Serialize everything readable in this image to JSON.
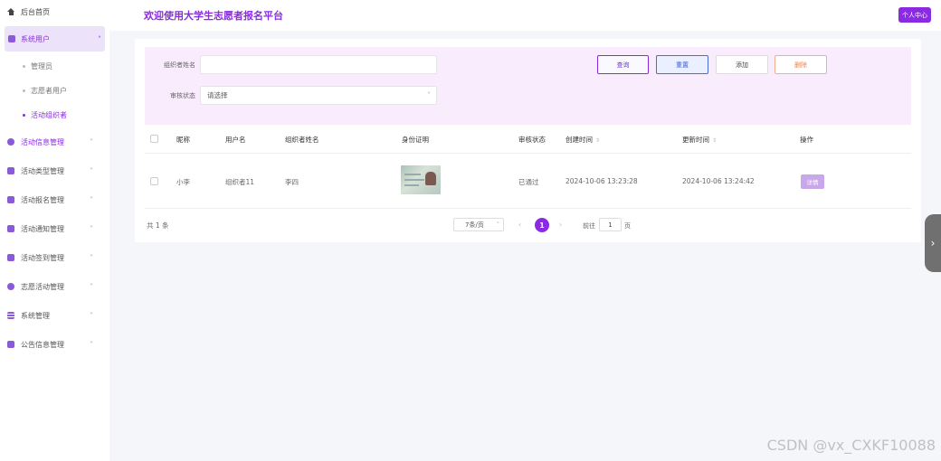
{
  "sidebar": {
    "home": "后台首页",
    "group": "系统用户",
    "subitems": [
      "管理员",
      "志愿者用户",
      "活动组织者"
    ],
    "items": [
      "活动信息管理",
      "活动类型管理",
      "活动报名管理",
      "活动通知管理",
      "活动签到管理",
      "志愿活动管理",
      "系统管理",
      "公告信息管理"
    ]
  },
  "header": {
    "title": "欢迎使用大学生志愿者报名平台",
    "profile": "个人中心"
  },
  "filter": {
    "name_label": "组织者姓名",
    "name_value": "",
    "status_label": "审核状态",
    "status_placeholder": "请选择",
    "buttons": {
      "search": "查询",
      "reset": "重置",
      "add": "添加",
      "delete": "删除"
    }
  },
  "table": {
    "headers": [
      "昵称",
      "用户名",
      "组织者姓名",
      "身份证明",
      "审核状态",
      "创建时间",
      "更新时间",
      "操作"
    ],
    "rows": [
      {
        "nickname": "小李",
        "username": "组织者11",
        "name": "李四",
        "status": "已通过",
        "created": "2024-10-06 13:23:28",
        "updated": "2024-10-06 13:24:42",
        "action": "详情"
      }
    ]
  },
  "pagination": {
    "total": "共 1 条",
    "page_size": "7条/页",
    "current": "1",
    "goto_label": "前往",
    "goto_value": "1",
    "page_suffix": "页"
  },
  "watermark": "CSDN @vx_CXKF10088",
  "colors": {
    "accent": "#8a2be2",
    "filter_bg": "#f8ecfd"
  }
}
